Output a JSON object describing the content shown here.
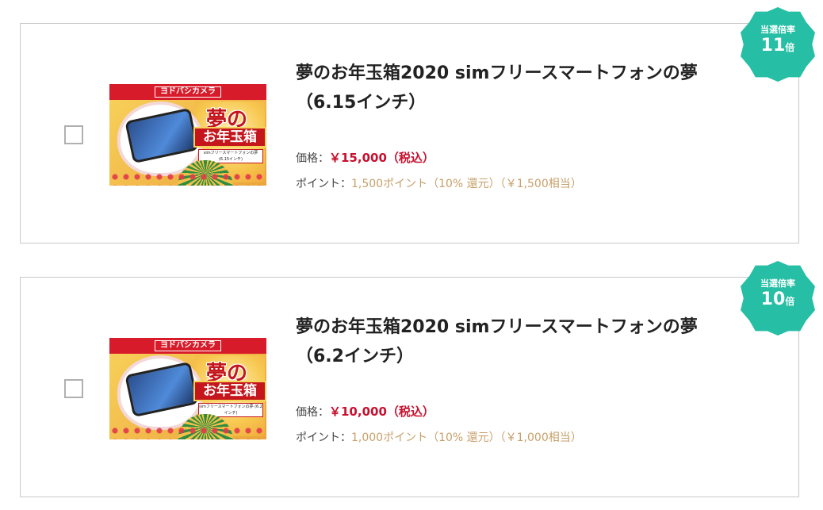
{
  "products": [
    {
      "title": "夢のお年玉箱2020 simフリースマートフォンの夢（6.15インチ）",
      "price_label": "価格：",
      "price": "￥15,000（税込）",
      "point_label": "ポイント：",
      "point": "1,500ポイント（10% 還元）（￥1,500相当）",
      "badge_label": "当選倍率",
      "badge_number": "11",
      "badge_unit": "倍",
      "image_store": "ヨドバシカメラ",
      "image_title_top": "夢の",
      "image_title_main": "お年玉箱",
      "image_sublabel": "simフリースマートフォンの夢 (6.15インチ)"
    },
    {
      "title": "夢のお年玉箱2020 simフリースマートフォンの夢（6.2インチ）",
      "price_label": "価格：",
      "price": "￥10,000（税込）",
      "point_label": "ポイント：",
      "point": "1,000ポイント（10% 還元）（￥1,000相当）",
      "badge_label": "当選倍率",
      "badge_number": "10",
      "badge_unit": "倍",
      "image_store": "ヨドバシカメラ",
      "image_title_top": "夢の",
      "image_title_main": "お年玉箱",
      "image_sublabel": "simフリースマートフォンの夢 (6.2インチ)"
    }
  ],
  "colors": {
    "badge": "#26bfa5",
    "price": "#c8102e",
    "point": "#c7a06a",
    "border": "#c8c8c8"
  }
}
